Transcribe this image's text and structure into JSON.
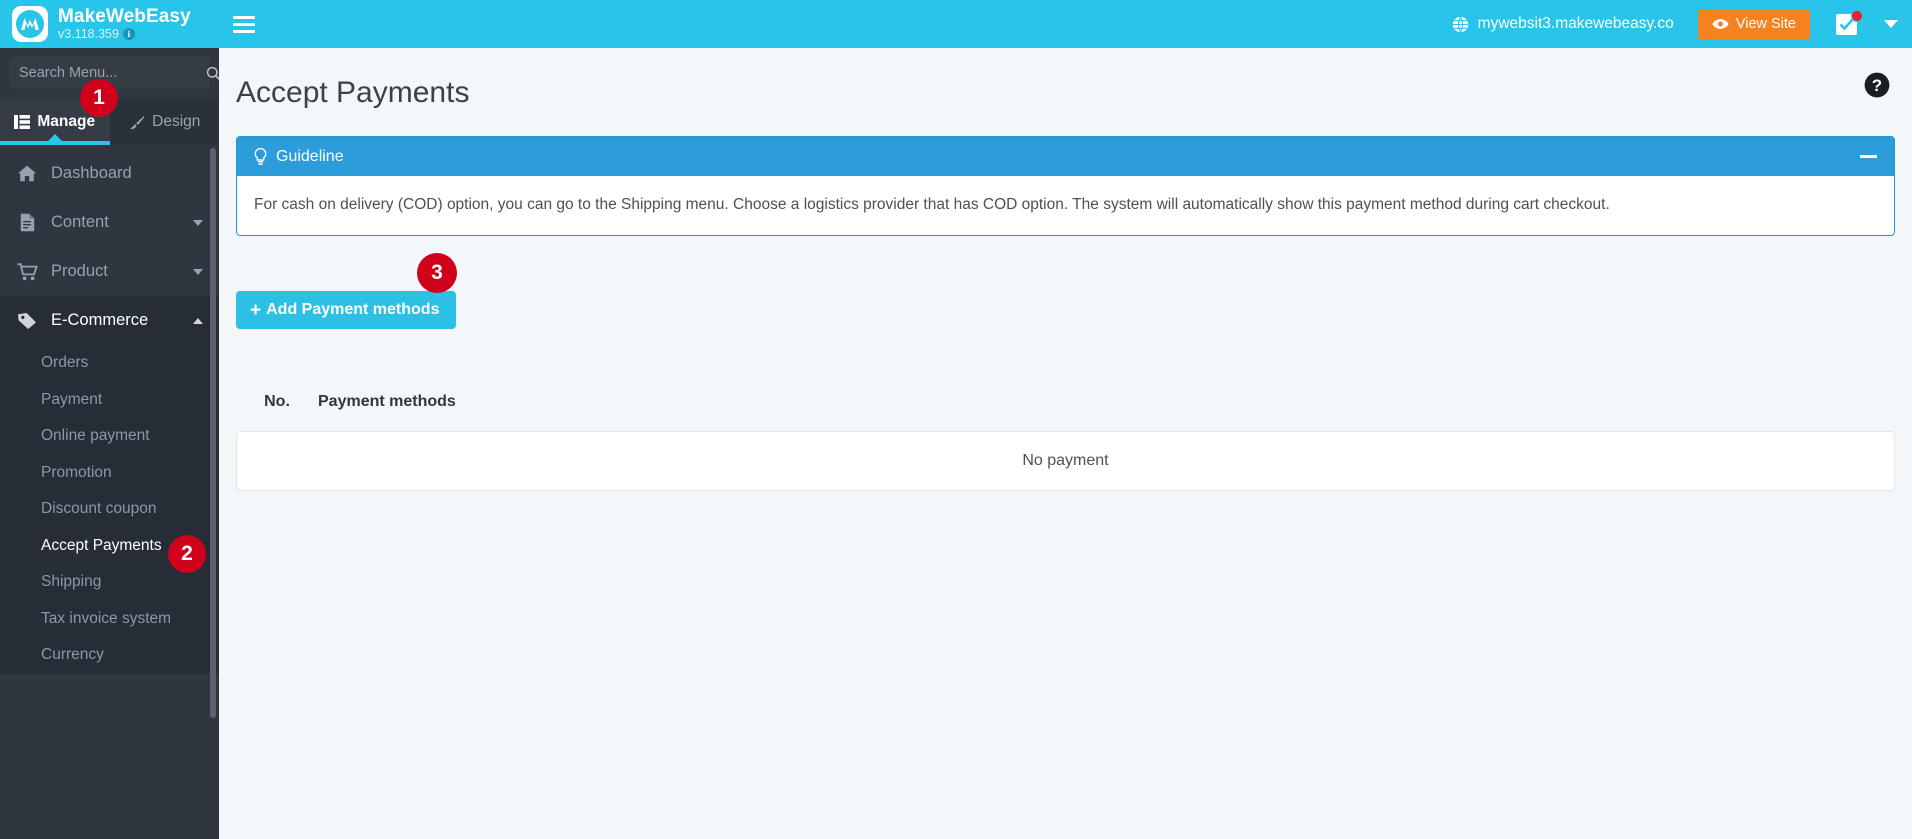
{
  "header": {
    "brand_name": "MakeWebEasy",
    "version": "v3.118.359",
    "info_char": "i",
    "site_url": "mywebsit3.makewebeasy.co",
    "view_site_label": "View Site"
  },
  "sidebar": {
    "search_placeholder": "Search Menu...",
    "search_value": "",
    "tabs": [
      {
        "label": "Manage",
        "icon": "grid-icon",
        "active": true
      },
      {
        "label": "Design",
        "icon": "brush-icon",
        "active": false
      }
    ],
    "items": [
      {
        "label": "Dashboard",
        "icon": "home-icon"
      },
      {
        "label": "Content",
        "icon": "document-icon"
      },
      {
        "label": "Product",
        "icon": "cart-icon"
      },
      {
        "label": "E-Commerce",
        "icon": "tag-icon"
      }
    ],
    "submenu": [
      {
        "label": "Orders"
      },
      {
        "label": "Payment"
      },
      {
        "label": "Online payment"
      },
      {
        "label": "Promotion"
      },
      {
        "label": "Discount coupon"
      },
      {
        "label": "Accept Payments"
      },
      {
        "label": "Shipping"
      },
      {
        "label": "Tax invoice system"
      },
      {
        "label": "Currency"
      }
    ]
  },
  "steps": {
    "one": "1",
    "two": "2",
    "three": "3"
  },
  "main": {
    "page_title": "Accept Payments",
    "guideline": {
      "title": "Guideline",
      "body": "For cash on delivery (COD) option, you can go to the Shipping menu. Choose a logistics provider that has COD option. The system will automatically show this payment method during cart checkout."
    },
    "add_button_label": "Add Payment methods",
    "add_button_plus": "+",
    "table": {
      "columns": [
        "No.",
        "Payment methods"
      ],
      "empty_message": "No payment",
      "rows": []
    }
  },
  "colors": {
    "header_cyan": "#29c4ea",
    "sidebar_dark": "#2f3640",
    "submenu_dark": "#272d36",
    "accent_orange": "#f5811f",
    "panel_blue": "#2d9cdb",
    "button_cyan": "#2bc0e4",
    "badge_red": "#d0021b"
  }
}
